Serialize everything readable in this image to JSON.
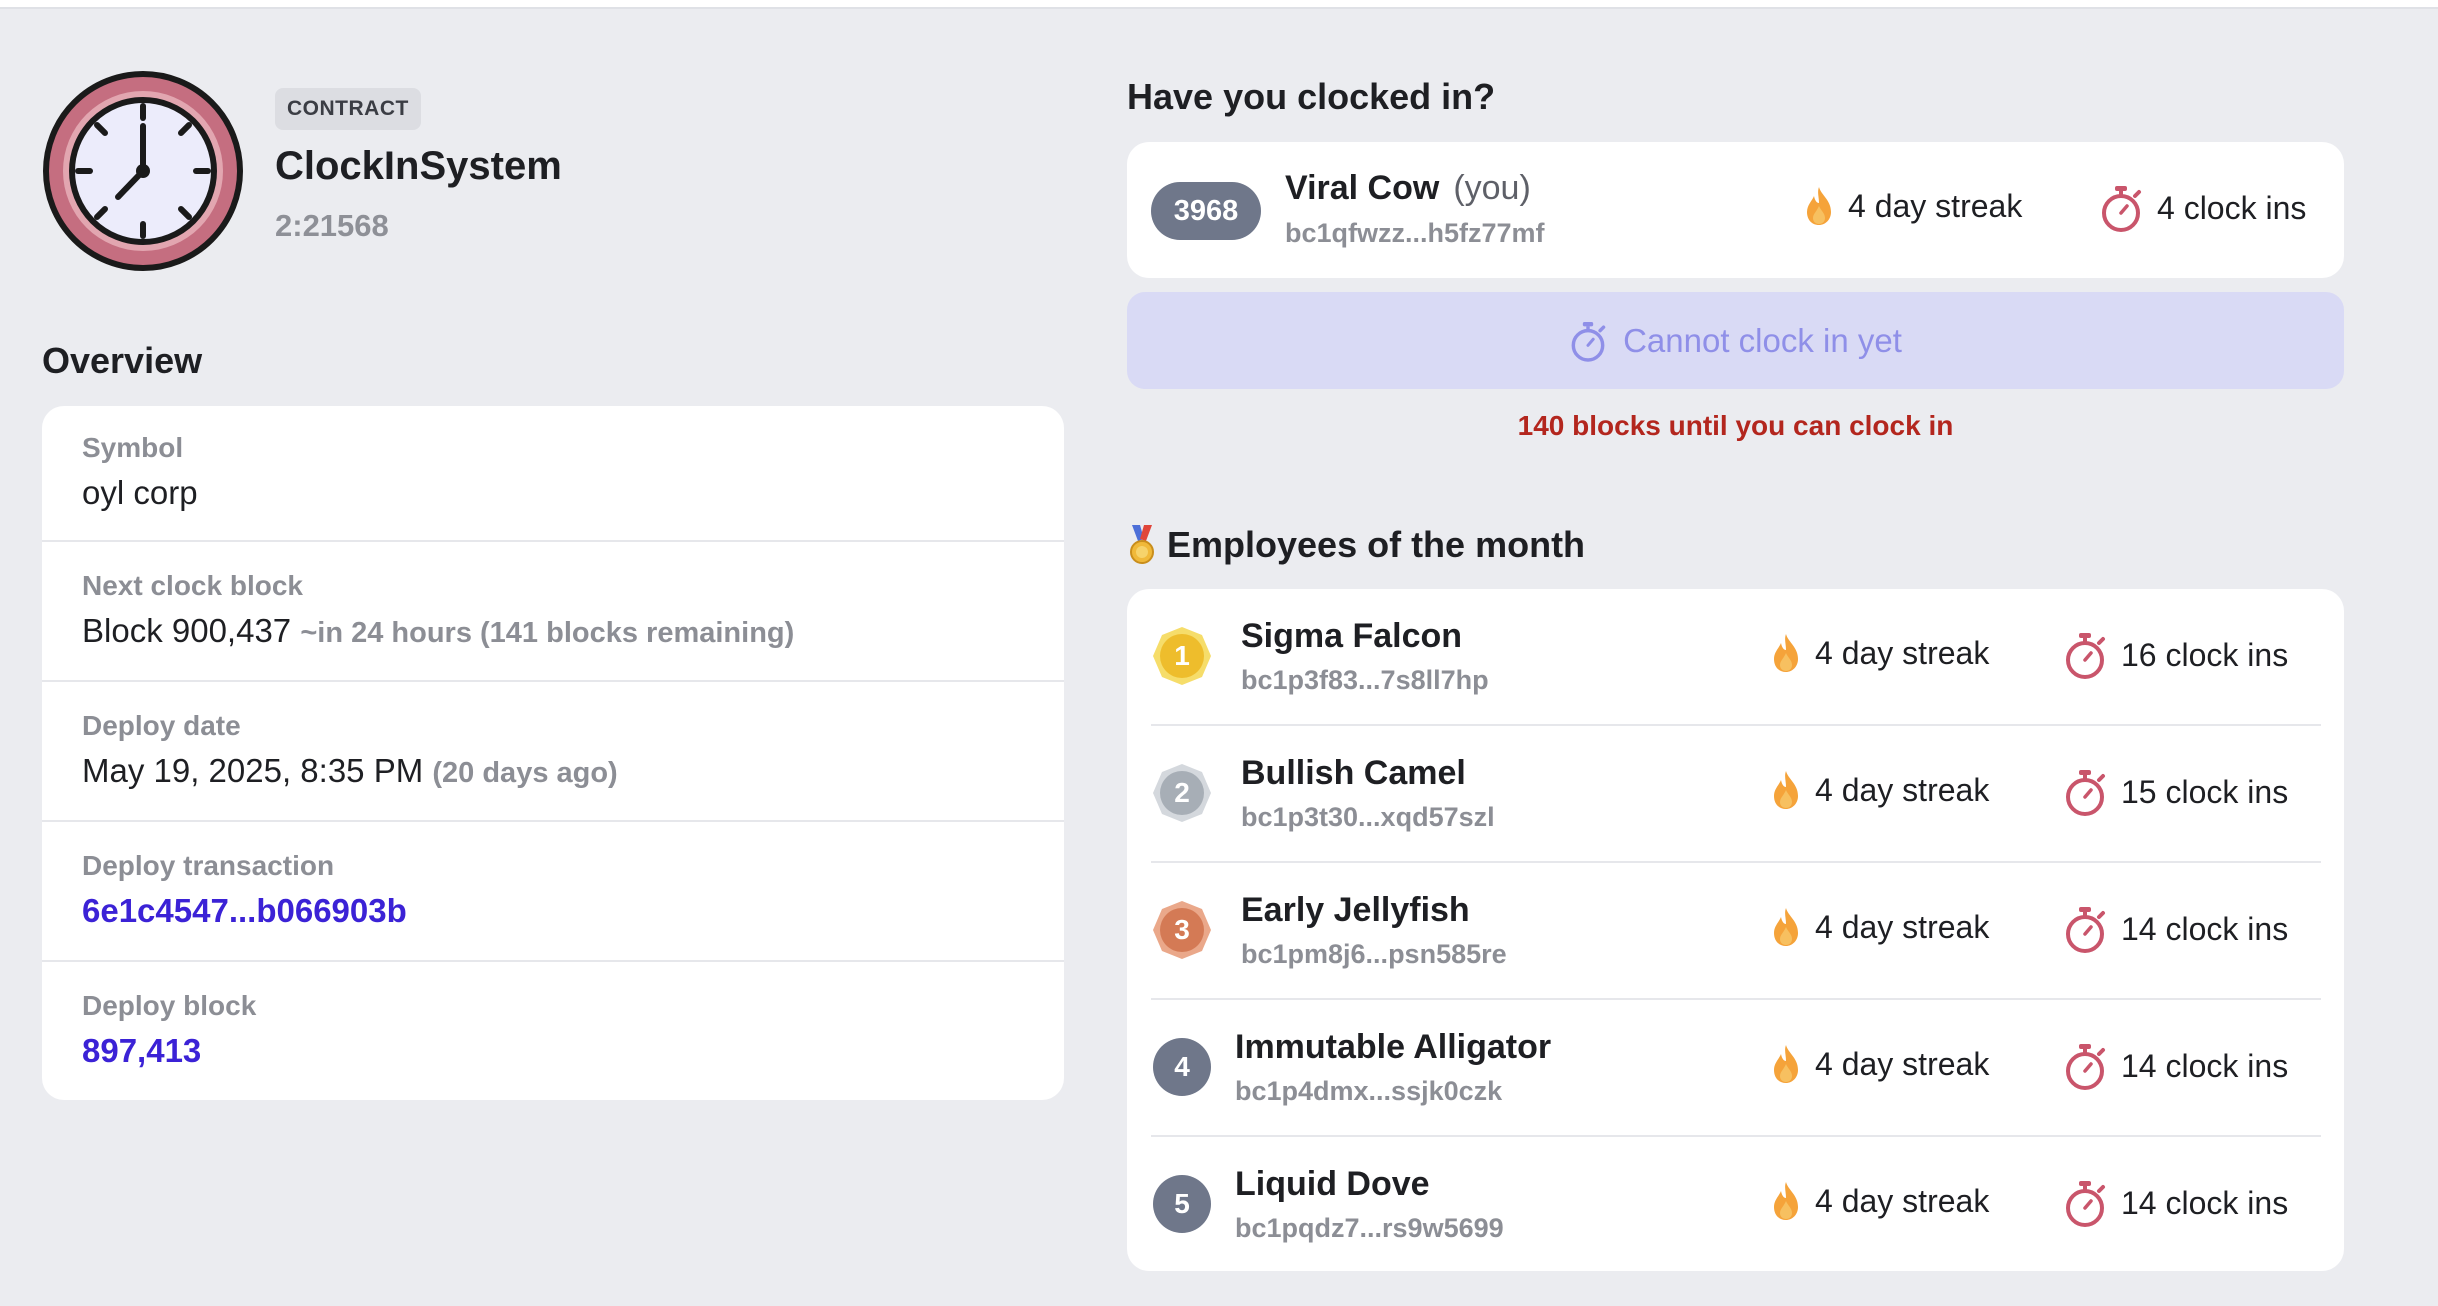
{
  "contract": {
    "tag": "CONTRACT",
    "name": "ClockInSystem",
    "id": "2:21568"
  },
  "overview": {
    "title": "Overview",
    "symbol_label": "Symbol",
    "symbol_value": "oyl corp",
    "next_block_label": "Next clock block",
    "next_block_value": "Block 900,437",
    "next_block_sub": "~in 24 hours (141 blocks remaining)",
    "deploy_date_label": "Deploy date",
    "deploy_date_value": "May 19, 2025, 8:35 PM",
    "deploy_date_sub": "(20 days ago)",
    "deploy_tx_label": "Deploy transaction",
    "deploy_tx_value": "6e1c4547...b066903b",
    "deploy_block_label": "Deploy block",
    "deploy_block_value": "897,413"
  },
  "clockin": {
    "title": "Have you clocked in?",
    "me": {
      "rank": "3968",
      "name": "Viral Cow",
      "you": "(you)",
      "address": "bc1qfwzz...h5fz77mf",
      "streak": "4 day streak",
      "clock_ins": "4 clock ins"
    },
    "button_label": "Cannot clock in yet",
    "warning": "140 blocks until you can clock in"
  },
  "employees": {
    "title": "Employees of the month",
    "rows": [
      {
        "rank": "1",
        "name": "Sigma Falcon",
        "address": "bc1p3f83...7s8ll7hp",
        "streak": "4 day streak",
        "clock_ins": "16 clock ins"
      },
      {
        "rank": "2",
        "name": "Bullish Camel",
        "address": "bc1p3t30...xqd57szl",
        "streak": "4 day streak",
        "clock_ins": "15 clock ins"
      },
      {
        "rank": "3",
        "name": "Early Jellyfish",
        "address": "bc1pm8j6...psn585re",
        "streak": "4 day streak",
        "clock_ins": "14 clock ins"
      },
      {
        "rank": "4",
        "name": "Immutable Alligator",
        "address": "bc1p4dmx...ssjk0czk",
        "streak": "4 day streak",
        "clock_ins": "14 clock ins"
      },
      {
        "rank": "5",
        "name": "Liquid Dove",
        "address": "bc1pqdz7...rs9w5699",
        "streak": "4 day streak",
        "clock_ins": "14 clock ins"
      }
    ]
  },
  "colors": {
    "accent_link": "#3b22d6",
    "warning": "#b3261e",
    "gold": "#f0c23a",
    "silver": "#a7aeb6",
    "bronze": "#d47a55",
    "rank_default": "#6f778a",
    "button_disabled_bg": "#d9daf5",
    "button_disabled_text": "#8f8fe8"
  },
  "icons": {
    "contract": "clock-icon",
    "streak": "fire-icon",
    "clock_ins": "stopwatch-icon",
    "medal": "medal-icon"
  }
}
